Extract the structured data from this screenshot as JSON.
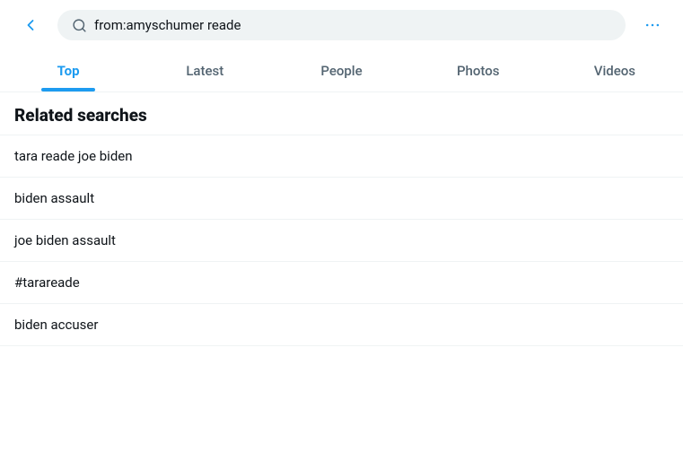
{
  "header": {
    "search_query": "from:amyschumer reade",
    "more_label": "···"
  },
  "tabs": [
    {
      "id": "top",
      "label": "Top",
      "active": true
    },
    {
      "id": "latest",
      "label": "Latest",
      "active": false
    },
    {
      "id": "people",
      "label": "People",
      "active": false
    },
    {
      "id": "photos",
      "label": "Photos",
      "active": false
    },
    {
      "id": "videos",
      "label": "Videos",
      "active": false
    }
  ],
  "related_searches": {
    "section_title": "Related searches",
    "items": [
      {
        "id": 1,
        "text": "tara reade joe biden"
      },
      {
        "id": 2,
        "text": "biden assault"
      },
      {
        "id": 3,
        "text": "joe biden assault"
      },
      {
        "id": 4,
        "text": "#tarareade"
      },
      {
        "id": 5,
        "text": "biden accuser"
      }
    ]
  },
  "icons": {
    "back": "←",
    "search": "🔍",
    "more": "•••"
  }
}
